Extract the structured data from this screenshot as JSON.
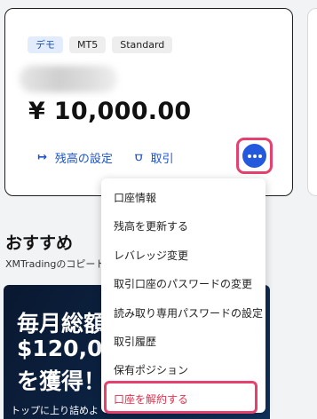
{
  "account_card": {
    "tags": [
      "デモ",
      "MT5",
      "Standard"
    ],
    "balance": "¥ 10,000.00",
    "actions": {
      "set_balance": {
        "icon": "↦",
        "label": "残高の設定"
      },
      "trade": {
        "icon": "⩌",
        "label": "取引"
      }
    }
  },
  "recommendations": {
    "title": "おすすめ",
    "subtitle": "XMTradingのコピート"
  },
  "banner": {
    "line1": "毎月総額",
    "line2": "$120,0",
    "line3": "を獲得！",
    "line4": "トップに上り詰めよ"
  },
  "menu": {
    "items": [
      "口座情報",
      "残高を更新する",
      "レバレッジ変更",
      "取引口座のパスワードの変更",
      "読み取り専用パスワードの設定",
      "取引履歴",
      "保有ポジション",
      "口座を解約する"
    ]
  },
  "colors": {
    "accent": "#2459de",
    "highlight": "#e5416f",
    "danger": "#e0304e"
  }
}
